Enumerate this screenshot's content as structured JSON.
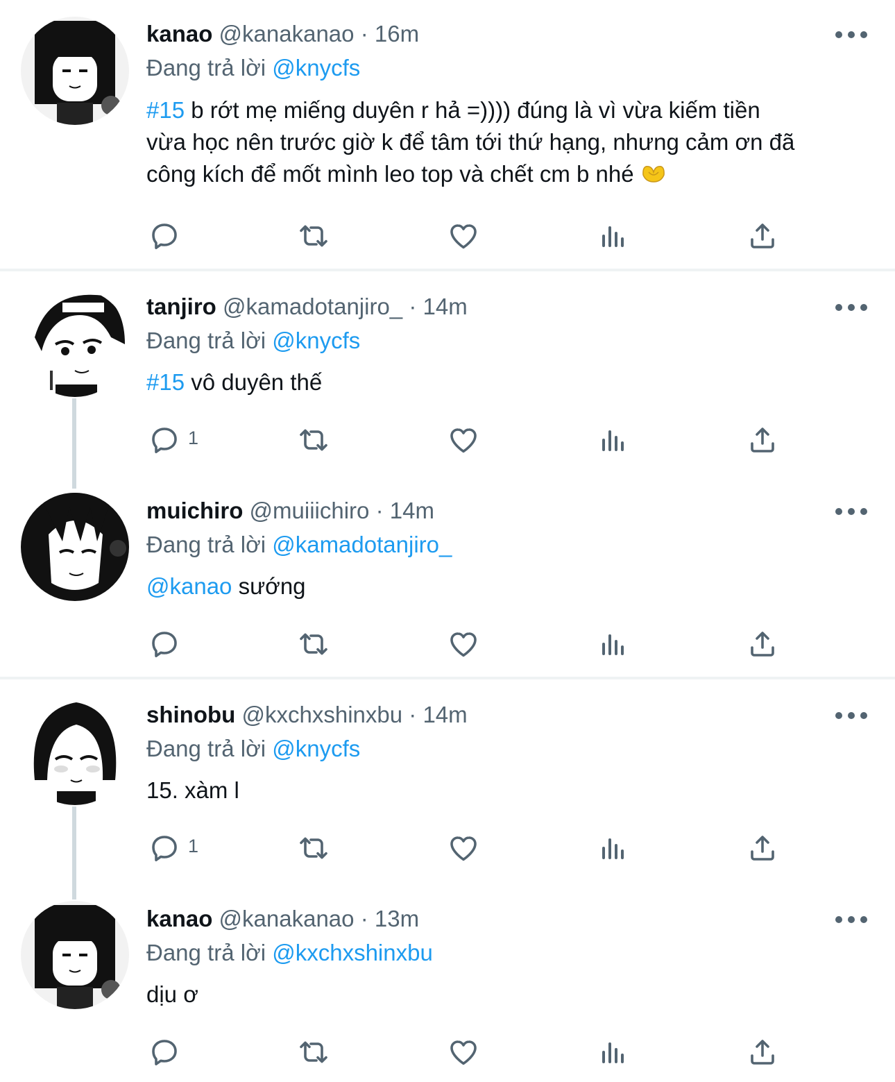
{
  "colors": {
    "accent": "#1d9bf0",
    "muted": "#536471",
    "text": "#0f1419",
    "divider": "#eff3f4"
  },
  "icons": {
    "reply": "speech-bubble-icon",
    "retweet": "retweet-arrows-icon",
    "like": "heart-icon",
    "views": "bar-chart-icon",
    "share": "share-upload-icon",
    "more": "ellipsis-icon"
  },
  "tweets": [
    {
      "name": "kanao",
      "handle": "@kanakanao",
      "dot": "·",
      "time": "16m",
      "replying_prefix": "Đang trả lời",
      "replying_to": "@knycfs",
      "body_lines": [
        {
          "tag": "#15",
          "text": " b rớt mẹ miếng duyên r hả =)))) đúng là vì vừa kiếm tiền"
        },
        {
          "text": "vừa học nên trước giờ k để tâm tới thứ hạng, nhưng cảm ơn đã"
        },
        {
          "text": "công kích để mốt mình leo top và chết cm b nhé "
        }
      ],
      "emoji": "heart-hands-emoji",
      "reply_count": ""
    },
    {
      "name": "tanjiro",
      "handle": "@kamadotanjiro_",
      "dot": "·",
      "time": "14m",
      "replying_prefix": "Đang trả lời",
      "replying_to": "@knycfs",
      "body_tag": "#15",
      "body_text": " vô duyên thế",
      "reply_count": "1"
    },
    {
      "name": "muichiro",
      "handle": "@muiiichiro",
      "dot": "·",
      "time": "14m",
      "replying_prefix": "Đang trả lời",
      "replying_to": "@kamadotanjiro_",
      "body_tag": "@kanao",
      "body_text": " sướng",
      "reply_count": ""
    },
    {
      "name": "shinobu",
      "handle": "@kxchxshinxbu",
      "dot": "·",
      "time": "14m",
      "replying_prefix": "Đang trả lời",
      "replying_to": "@knycfs",
      "body_text": "15. xàm l",
      "reply_count": "1"
    },
    {
      "name": "kanao",
      "handle": "@kanakanao",
      "dot": "·",
      "time": "13m",
      "replying_prefix": "Đang trả lời",
      "replying_to": "@kxchxshinxbu",
      "body_text": "dịu ơ",
      "reply_count": ""
    }
  ]
}
